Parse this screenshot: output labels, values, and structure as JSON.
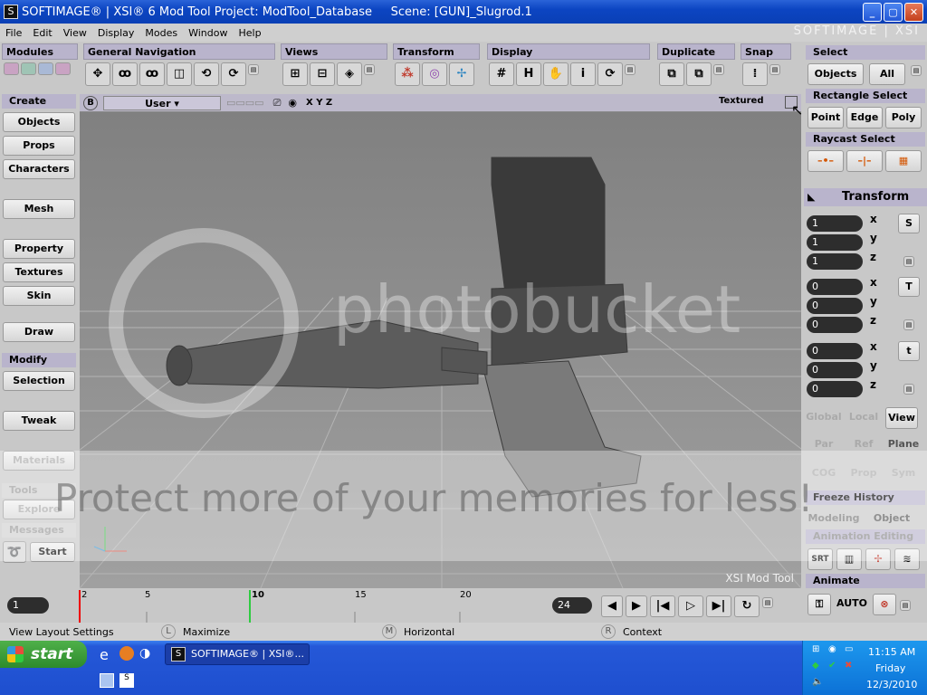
{
  "window": {
    "title": "SOFTIMAGE® | XSI® 6 Mod Tool Project: ModTool_Database     Scene: [GUN]_Slugrod.1",
    "brand": "SOFTIMAGE | XSI",
    "minimize": "_",
    "maximize": "▢",
    "close": "✕"
  },
  "menu": [
    "File",
    "Edit",
    "View",
    "Display",
    "Modes",
    "Window",
    "Help"
  ],
  "toolbars": {
    "modules": "Modules",
    "general_navigation": "General Navigation",
    "views": "Views",
    "transform": "Transform",
    "display": "Display",
    "duplicate": "Duplicate",
    "snap": "Snap"
  },
  "left_panel": {
    "create_header": "Create",
    "create_buttons": [
      "Objects",
      "Props",
      "Characters",
      "Mesh",
      "Property",
      "Textures",
      "Skin",
      "Draw"
    ],
    "modify_header": "Modify",
    "modify_buttons": [
      "Selection",
      "Tweak",
      "Materials"
    ],
    "tools_header": "Tools",
    "explore": "Explore",
    "messages_header": "Messages",
    "start": "Start"
  },
  "viewport": {
    "camera": "User",
    "axes": "X Y Z",
    "shading": "Textured",
    "corner_label": "XSI Mod Tool",
    "b_label": "B"
  },
  "right_panel": {
    "select_header": "Select",
    "objects": "Objects",
    "all": "All",
    "rect_select_header": "Rectangle Select",
    "point": "Point",
    "edge": "Edge",
    "poly": "Poly",
    "raycast_header": "Raycast Select",
    "transform_header": "Transform",
    "scale": {
      "x": "1",
      "y": "1",
      "z": "1",
      "icon": "S"
    },
    "rotate": {
      "x": "0",
      "y": "0",
      "z": "0",
      "icon": "T"
    },
    "translate": {
      "x": "0",
      "y": "0",
      "z": "0",
      "icon": "t"
    },
    "axis_labels": [
      "x",
      "y",
      "z"
    ],
    "global": "Global",
    "local": "Local",
    "view": "View",
    "par": "Par",
    "ref": "Ref",
    "plane": "Plane",
    "cog": "COG",
    "prop": "Prop",
    "sym": "Sym",
    "freeze_history": "Freeze History",
    "modeling": "Modeling",
    "object": "Object",
    "animation_editing": "Animation Editing",
    "srt": "SRT",
    "animate_header": "Animate",
    "auto": "AUTO"
  },
  "timeline": {
    "current_frame": "1",
    "ticks": [
      "2",
      "5",
      "10",
      "15",
      "20"
    ],
    "end_frame": "24"
  },
  "statusbar": {
    "left": "View Layout Settings",
    "l_key": "L",
    "l_label": "Maximize",
    "m_key": "M",
    "m_label": "Horizontal",
    "r_key": "R",
    "r_label": "Context"
  },
  "taskbar": {
    "start": "start",
    "task_item": "SOFTIMAGE® | XSI®...",
    "time": "11:15 AM",
    "day": "Friday",
    "date": "12/3/2010"
  },
  "watermark": {
    "logo": "photobucket",
    "banner": "Protect more of your memories for less!"
  }
}
